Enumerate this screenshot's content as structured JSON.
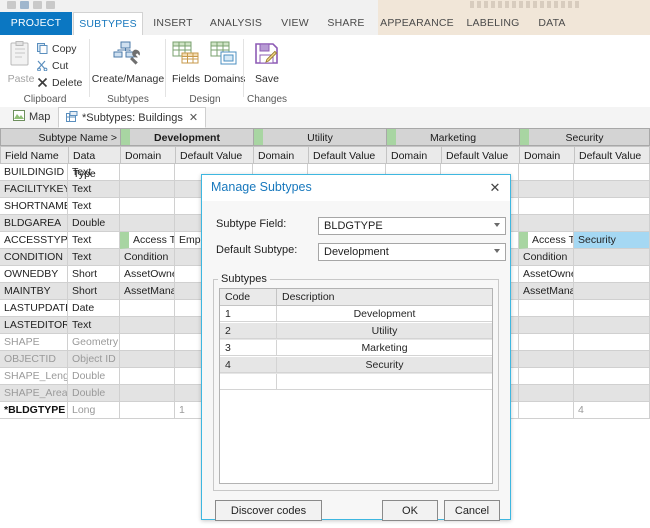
{
  "window": {
    "quick_access": [
      "save-icon",
      "undo-icon",
      "redo-icon",
      "customize-icon"
    ]
  },
  "ribbon": {
    "tabs": [
      {
        "label": "PROJECT",
        "state": "project"
      },
      {
        "label": "SUBTYPES",
        "state": "active"
      },
      {
        "label": "INSERT",
        "state": "normal"
      },
      {
        "label": "ANALYSIS",
        "state": "normal"
      },
      {
        "label": "VIEW",
        "state": "normal"
      },
      {
        "label": "SHARE",
        "state": "normal"
      },
      {
        "label": "APPEARANCE",
        "state": "contextual"
      },
      {
        "label": "LABELING",
        "state": "contextual"
      },
      {
        "label": "DATA",
        "state": "contextual"
      }
    ],
    "groups": [
      {
        "label": "Clipboard"
      },
      {
        "label": "Subtypes"
      },
      {
        "label": "Design"
      },
      {
        "label": "Changes"
      }
    ],
    "clipboard": {
      "paste_label": "Paste",
      "copy_label": "Copy",
      "cut_label": "Cut",
      "delete_label": "Delete"
    },
    "subtypes_group": {
      "create_manage_label": "Create/Manage"
    },
    "design_group": {
      "fields_label": "Fields",
      "domains_label": "Domains"
    },
    "changes_group": {
      "save_label": "Save"
    }
  },
  "doc_tabs": [
    {
      "label": "Map",
      "selected": false,
      "closable": false
    },
    {
      "label": "*Subtypes: Buildings",
      "selected": true,
      "closable": true,
      "close_glyph": "✕"
    }
  ],
  "grid": {
    "subtype_name_header": "Subtype Name >",
    "subtype_columns": [
      {
        "name": "Development",
        "bold": true
      },
      {
        "name": "Utility",
        "bold": false
      },
      {
        "name": "Marketing",
        "bold": false
      },
      {
        "name": "Security",
        "bold": false
      }
    ],
    "columns": {
      "field_name": "Field Name",
      "data_type": "Data Type",
      "domain": "Domain",
      "default_value": "Default Value"
    },
    "rows": [
      {
        "field": "BUILDINGID",
        "type": "Text",
        "dim": false,
        "bold": false,
        "development": {
          "domain": "",
          "default": ""
        },
        "utility": {
          "domain": "",
          "default": ""
        },
        "marketing": {
          "domain": "",
          "default": ""
        },
        "security": {
          "domain": "",
          "default": ""
        }
      },
      {
        "field": "FACILITYKEY",
        "type": "Text",
        "dim": false,
        "bold": false,
        "development": {
          "domain": "",
          "default": ""
        },
        "utility": {
          "domain": "",
          "default": ""
        },
        "marketing": {
          "domain": "",
          "default": ""
        },
        "security": {
          "domain": "",
          "default": ""
        }
      },
      {
        "field": "SHORTNAME",
        "type": "Text",
        "dim": false,
        "bold": false,
        "development": {
          "domain": "",
          "default": ""
        },
        "utility": {
          "domain": "",
          "default": ""
        },
        "marketing": {
          "domain": "",
          "default": ""
        },
        "security": {
          "domain": "",
          "default": ""
        }
      },
      {
        "field": "BLDGAREA",
        "type": "Double",
        "dim": false,
        "bold": false,
        "development": {
          "domain": "",
          "default": ""
        },
        "utility": {
          "domain": "",
          "default": ""
        },
        "marketing": {
          "domain": "",
          "default": ""
        },
        "security": {
          "domain": "",
          "default": ""
        }
      },
      {
        "field": "ACCESSTYPE",
        "type": "Text",
        "dim": false,
        "bold": false,
        "development": {
          "domain": "Access Type",
          "default": "Emp",
          "marked": true
        },
        "utility": {
          "domain": "",
          "default": ""
        },
        "marketing": {
          "domain": "",
          "default": ""
        },
        "security": {
          "domain": "Access Type",
          "default": "Security",
          "marked": true,
          "selected": true
        }
      },
      {
        "field": "CONDITION",
        "type": "Text",
        "dim": false,
        "bold": false,
        "development": {
          "domain": "Condition",
          "default": ""
        },
        "utility": {
          "domain": "",
          "default": ""
        },
        "marketing": {
          "domain": "",
          "default": ""
        },
        "security": {
          "domain": "Condition",
          "default": ""
        }
      },
      {
        "field": "OWNEDBY",
        "type": "Short",
        "dim": false,
        "bold": false,
        "development": {
          "domain": "AssetOwner",
          "default": ""
        },
        "utility": {
          "domain": "",
          "default": ""
        },
        "marketing": {
          "domain": "",
          "default": ""
        },
        "security": {
          "domain": "AssetOwner",
          "default": ""
        }
      },
      {
        "field": "MAINTBY",
        "type": "Short",
        "dim": false,
        "bold": false,
        "development": {
          "domain": "AssetManager",
          "default": ""
        },
        "utility": {
          "domain": "",
          "default": ""
        },
        "marketing": {
          "domain": "",
          "default": ""
        },
        "security": {
          "domain": "AssetManager",
          "default": ""
        }
      },
      {
        "field": "LASTUPDATE",
        "type": "Date",
        "dim": false,
        "bold": false,
        "development": {
          "domain": "",
          "default": ""
        },
        "utility": {
          "domain": "",
          "default": ""
        },
        "marketing": {
          "domain": "",
          "default": ""
        },
        "security": {
          "domain": "",
          "default": ""
        }
      },
      {
        "field": "LASTEDITOR",
        "type": "Text",
        "dim": false,
        "bold": false,
        "development": {
          "domain": "",
          "default": ""
        },
        "utility": {
          "domain": "",
          "default": ""
        },
        "marketing": {
          "domain": "",
          "default": ""
        },
        "security": {
          "domain": "",
          "default": ""
        }
      },
      {
        "field": "SHAPE",
        "type": "Geometry",
        "dim": true,
        "bold": false,
        "development": {
          "domain": "",
          "default": ""
        },
        "utility": {
          "domain": "",
          "default": ""
        },
        "marketing": {
          "domain": "",
          "default": ""
        },
        "security": {
          "domain": "",
          "default": ""
        }
      },
      {
        "field": "OBJECTID",
        "type": "Object ID",
        "dim": true,
        "bold": false,
        "development": {
          "domain": "",
          "default": ""
        },
        "utility": {
          "domain": "",
          "default": ""
        },
        "marketing": {
          "domain": "",
          "default": ""
        },
        "security": {
          "domain": "",
          "default": ""
        }
      },
      {
        "field": "SHAPE_Length",
        "type": "Double",
        "dim": true,
        "bold": false,
        "development": {
          "domain": "",
          "default": ""
        },
        "utility": {
          "domain": "",
          "default": ""
        },
        "marketing": {
          "domain": "",
          "default": ""
        },
        "security": {
          "domain": "",
          "default": ""
        }
      },
      {
        "field": "SHAPE_Area",
        "type": "Double",
        "dim": true,
        "bold": false,
        "development": {
          "domain": "",
          "default": ""
        },
        "utility": {
          "domain": "",
          "default": ""
        },
        "marketing": {
          "domain": "",
          "default": ""
        },
        "security": {
          "domain": "",
          "default": ""
        }
      },
      {
        "field": "*BLDGTYPE",
        "type": "Long",
        "dim": true,
        "bold": true,
        "development": {
          "domain": "",
          "default": "1"
        },
        "utility": {
          "domain": "",
          "default": ""
        },
        "marketing": {
          "domain": "",
          "default": ""
        },
        "security": {
          "domain": "",
          "default": "4"
        }
      }
    ]
  },
  "dialog": {
    "title": "Manage Subtypes",
    "close_glyph": "✕",
    "subtype_field_label": "Subtype Field:",
    "subtype_field_value": "BLDGTYPE",
    "default_subtype_label": "Default Subtype:",
    "default_subtype_value": "Development",
    "subtypes_legend": "Subtypes",
    "grid_headers": {
      "code": "Code",
      "description": "Description"
    },
    "grid_rows": [
      {
        "code": "1",
        "description": "Development"
      },
      {
        "code": "2",
        "description": "Utility"
      },
      {
        "code": "3",
        "description": "Marketing"
      },
      {
        "code": "4",
        "description": "Security"
      },
      {
        "code": "",
        "description": ""
      }
    ],
    "buttons": {
      "discover": "Discover codes",
      "ok": "OK",
      "cancel": "Cancel"
    }
  },
  "colors": {
    "accent_blue": "#0b77c2",
    "tab_text_blue": "#1878bd",
    "contextual_tint": "#f1e6d8",
    "subtype_marker_green": "#a8d5a2",
    "selection_blue": "#a5d8f3",
    "dialog_border": "#3eb7e0"
  }
}
